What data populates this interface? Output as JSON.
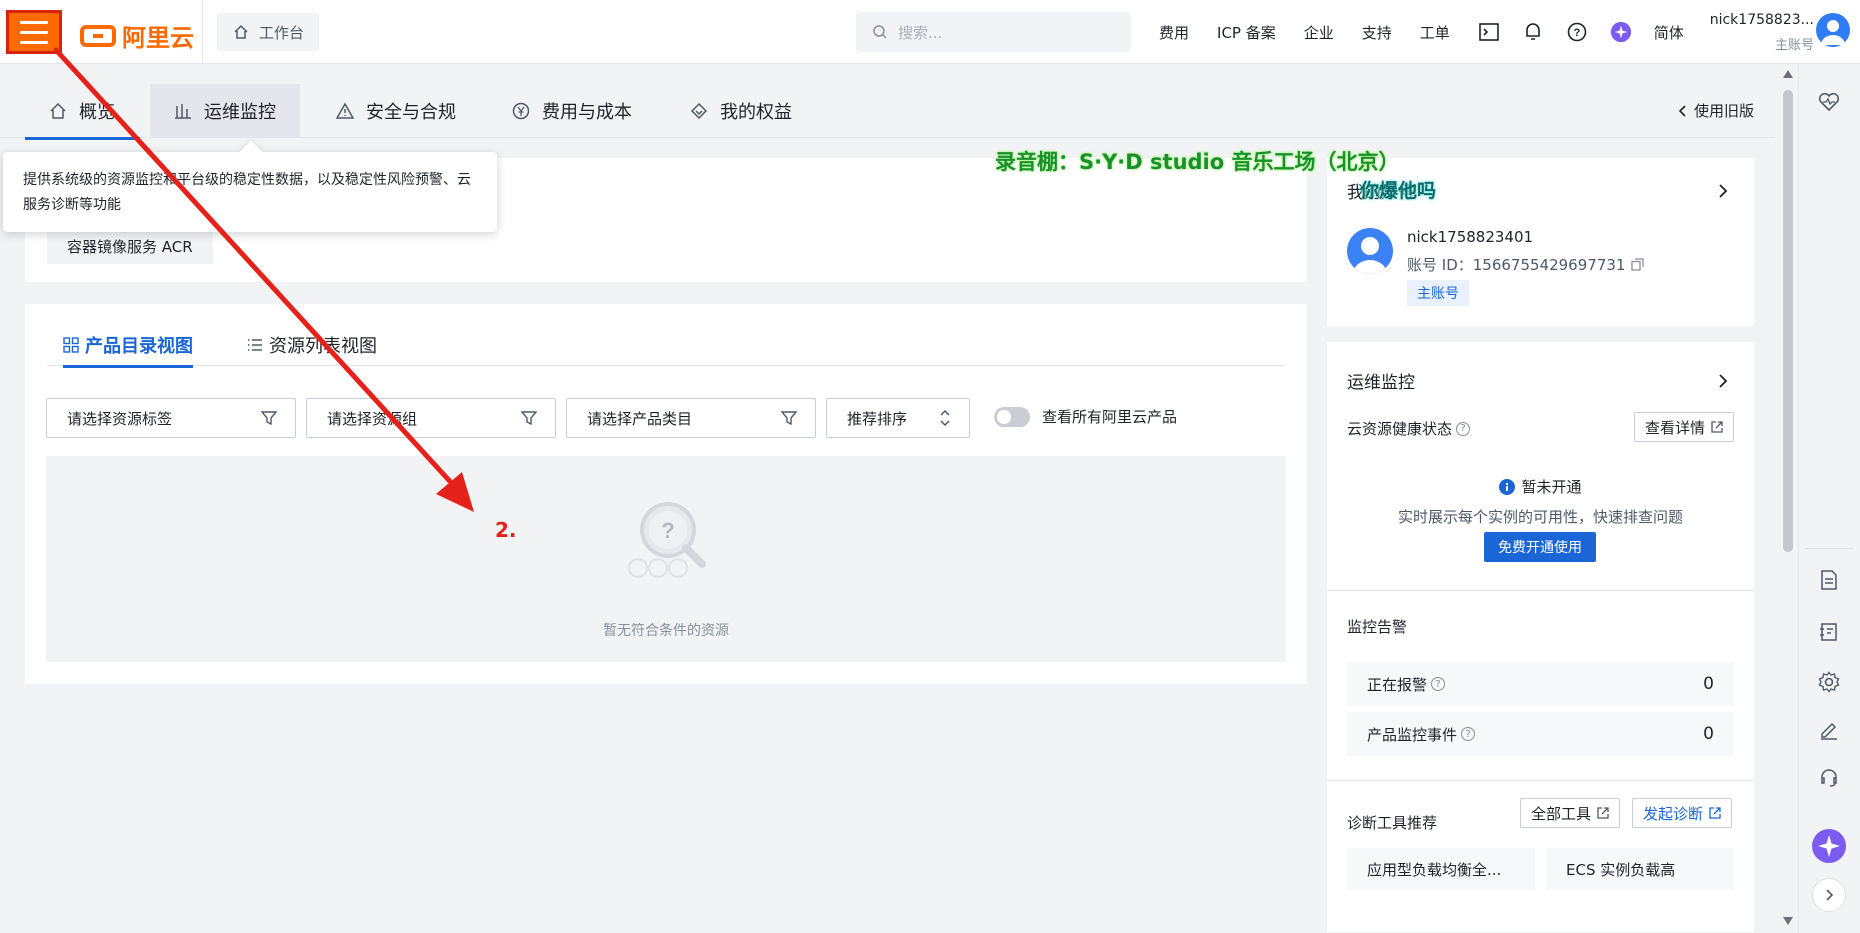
{
  "topbar": {
    "brand": "阿里云",
    "workbench": "工作台",
    "search_placeholder": "搜索...",
    "nav": [
      "费用",
      "ICP 备案",
      "企业",
      "支持",
      "工单"
    ],
    "lang": "简体",
    "user_name": "nick1758823...",
    "user_role": "主账号"
  },
  "tabs": [
    {
      "label": "概览",
      "icon": "home-icon"
    },
    {
      "label": "运维监控",
      "icon": "bar-chart-icon"
    },
    {
      "label": "安全与合规",
      "icon": "warning-icon"
    },
    {
      "label": "费用与成本",
      "icon": "yen-icon"
    },
    {
      "label": "我的权益",
      "icon": "diamond-icon"
    }
  ],
  "old_version": "使用旧版",
  "tooltip": "提供系统级的资源监控和平台级的稳定性数据，以及稳定性风险预警、云服务诊断等功能",
  "recent": {
    "tag": "容器镜像服务 ACR"
  },
  "resources": {
    "view_tabs": [
      "产品目录视图",
      "资源列表视图"
    ],
    "filters": [
      "请选择资源标签",
      "请选择资源组",
      "请选择产品类目"
    ],
    "sort": "推荐排序",
    "toggle_label": "查看所有阿里云产品",
    "empty_text": "暂无符合条件的资源"
  },
  "account": {
    "title": "我的账号",
    "name": "nick1758823401",
    "id_label": "账号 ID：",
    "id_value": "1566755429697731",
    "badge": "主账号"
  },
  "ops": {
    "title": "运维监控",
    "health_label": "云资源健康状态",
    "detail_btn": "查看详情",
    "status": "暂未开通",
    "desc": "实时展示每个实例的可用性，快速排查问题",
    "activate_btn": "免费开通使用",
    "alarm_title": "监控告警",
    "alarms": [
      {
        "label": "正在报警",
        "value": "0"
      },
      {
        "label": "产品监控事件",
        "value": "0"
      }
    ],
    "diag_title": "诊断工具推荐",
    "all_tools": "全部工具",
    "start_diag": "发起诊断",
    "tools": [
      "应用型负载均衡全...",
      "ECS 实例负载高"
    ]
  },
  "overlay": {
    "watermark": "录音棚：S·Y·D studio 音乐工场（北京）",
    "watermark2": "你爆他吗",
    "step": "2."
  },
  "colors": {
    "accent": "#1a66d6",
    "brand": "#ff6a00",
    "arrow": "#e6211a"
  }
}
